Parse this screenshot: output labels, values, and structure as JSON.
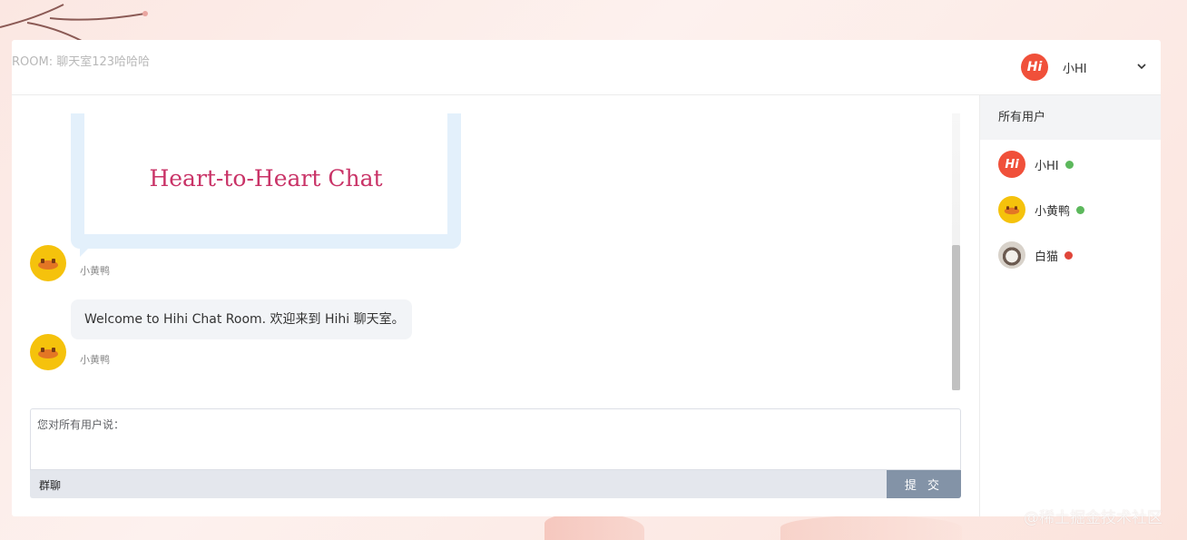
{
  "header": {
    "room_title": "ROOM: 聊天室123哈哈哈",
    "current_user": "小HI",
    "logo_text": "Hi"
  },
  "messages": [
    {
      "type": "image",
      "sender": "小黄鸭",
      "image_caption": "Heart-to-Heart Chat"
    },
    {
      "type": "text",
      "sender": "小黄鸭",
      "text": "Welcome to Hihi Chat Room. 欢迎来到 Hihi 聊天室。"
    }
  ],
  "composer": {
    "placeholder": "您对所有用户说：",
    "mode_label": "群聊",
    "submit_label": "提 交"
  },
  "users_panel": {
    "title": "所有用户",
    "users": [
      {
        "name": "小HI",
        "status": "online",
        "status_color": "#5cb85c",
        "avatar": "hi-logo"
      },
      {
        "name": "小黄鸭",
        "status": "online",
        "status_color": "#5cb85c",
        "avatar": "duck-avatar"
      },
      {
        "name": "白猫",
        "status": "offline",
        "status_color": "#e0463a",
        "avatar": "cat-avatar"
      }
    ]
  },
  "colors": {
    "accent_red": "#f0503a",
    "duck_yellow": "#f5c20c",
    "caption_pink": "#c93367",
    "submit_bg": "#8393a7"
  },
  "watermark": "@稀土掘金技术社区"
}
